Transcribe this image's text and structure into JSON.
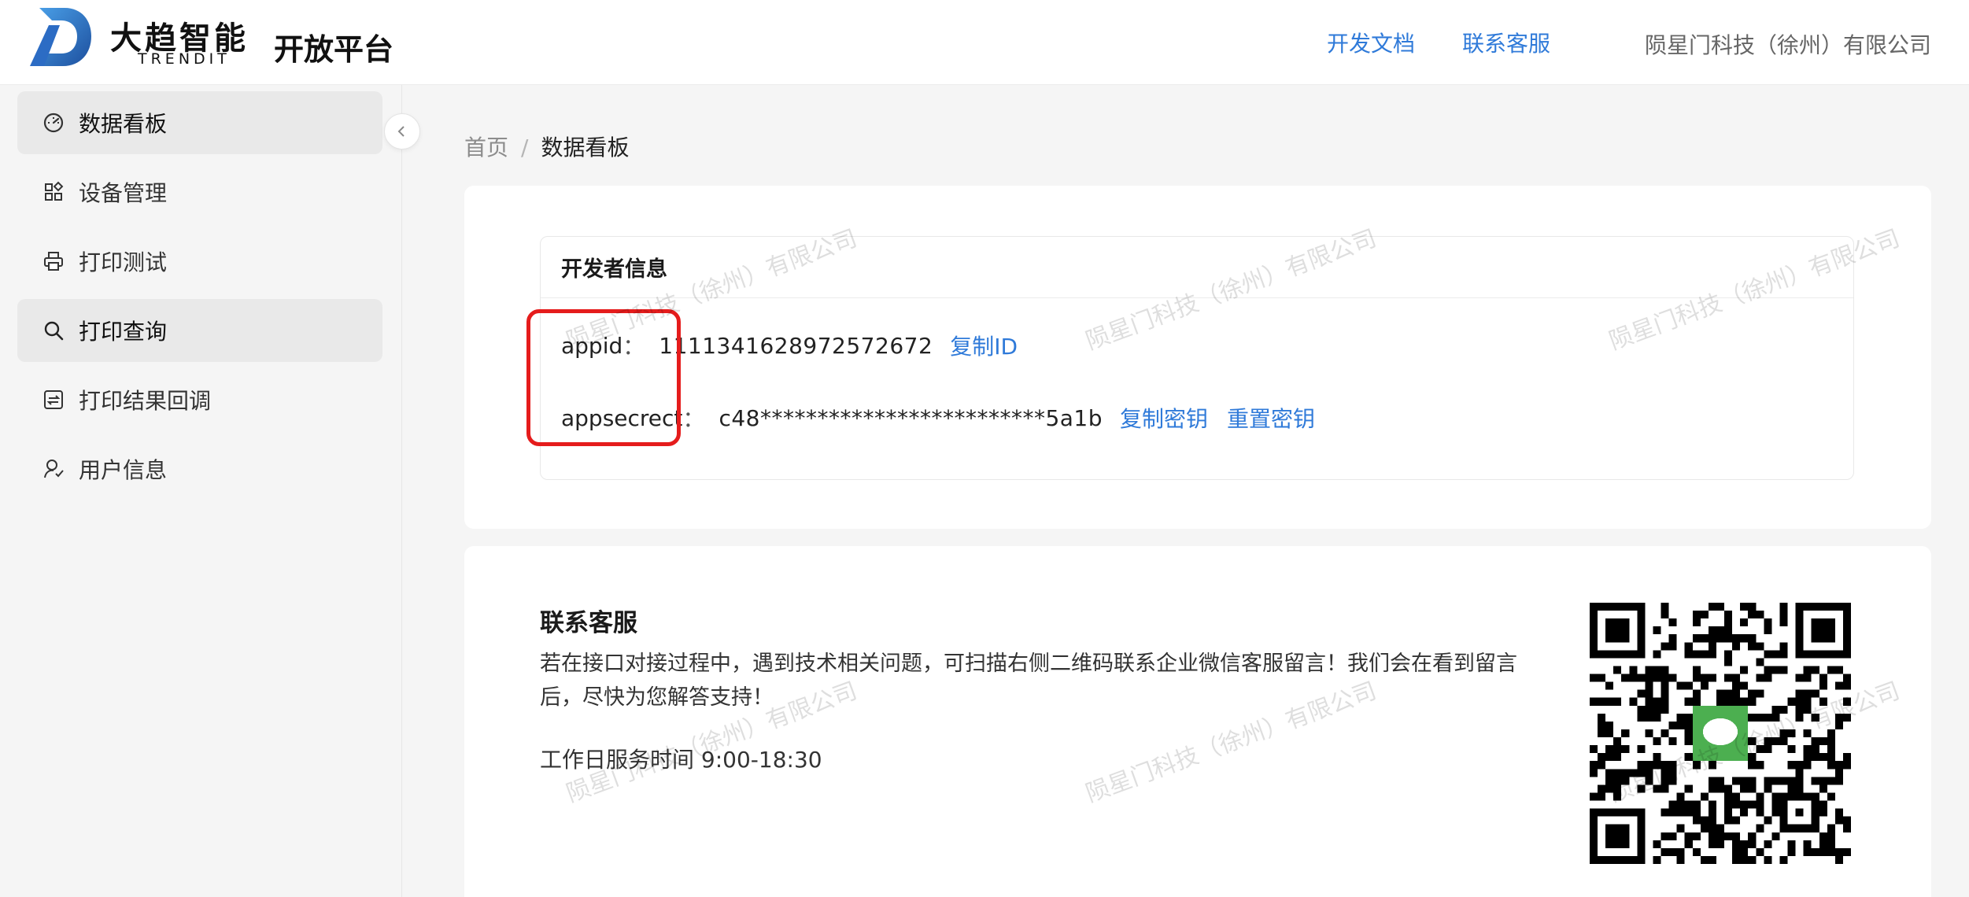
{
  "header": {
    "brand_cn": "大趋智能",
    "brand_en": "TRENDIT",
    "platform_title": "开放平台",
    "nav": [
      {
        "label": "开发文档"
      },
      {
        "label": "联系客服"
      }
    ],
    "company": "陨星门科技（徐州）有限公司"
  },
  "sidebar": {
    "items": [
      {
        "label": "数据看板",
        "icon": "dashboard-icon",
        "active": true
      },
      {
        "label": "设备管理",
        "icon": "grid-icon",
        "active": false
      },
      {
        "label": "打印测试",
        "icon": "printer-icon",
        "active": false
      },
      {
        "label": "打印查询",
        "icon": "search-icon",
        "active": true
      },
      {
        "label": "打印结果回调",
        "icon": "callback-icon",
        "active": false
      },
      {
        "label": "用户信息",
        "icon": "user-icon",
        "active": false
      }
    ]
  },
  "breadcrumb": {
    "home": "首页",
    "separator": "/",
    "current": "数据看板"
  },
  "developer": {
    "title": "开发者信息",
    "appid_label": "appid",
    "appid_colon": "：",
    "appid_value": "1111341628972572672",
    "copy_id": "复制ID",
    "secret_label": "appsecrect",
    "secret_colon": "：",
    "secret_value": "c48*************************5a1b",
    "copy_secret": "复制密钥",
    "reset_secret": "重置密钥"
  },
  "support": {
    "title": "联系客服",
    "description": "若在接口对接过程中，遇到技术相关问题，可扫描右侧二维码联系企业微信客服留言！我们会在看到留言后，尽快为您解答支持！",
    "hours": "工作日服务时间 9:00-18:30"
  },
  "watermark_text": "陨星门科技（徐州）有限公司",
  "colors": {
    "accent": "#2f7ad9",
    "highlight": "#e51c1c",
    "qr_center": "#4caf50"
  }
}
